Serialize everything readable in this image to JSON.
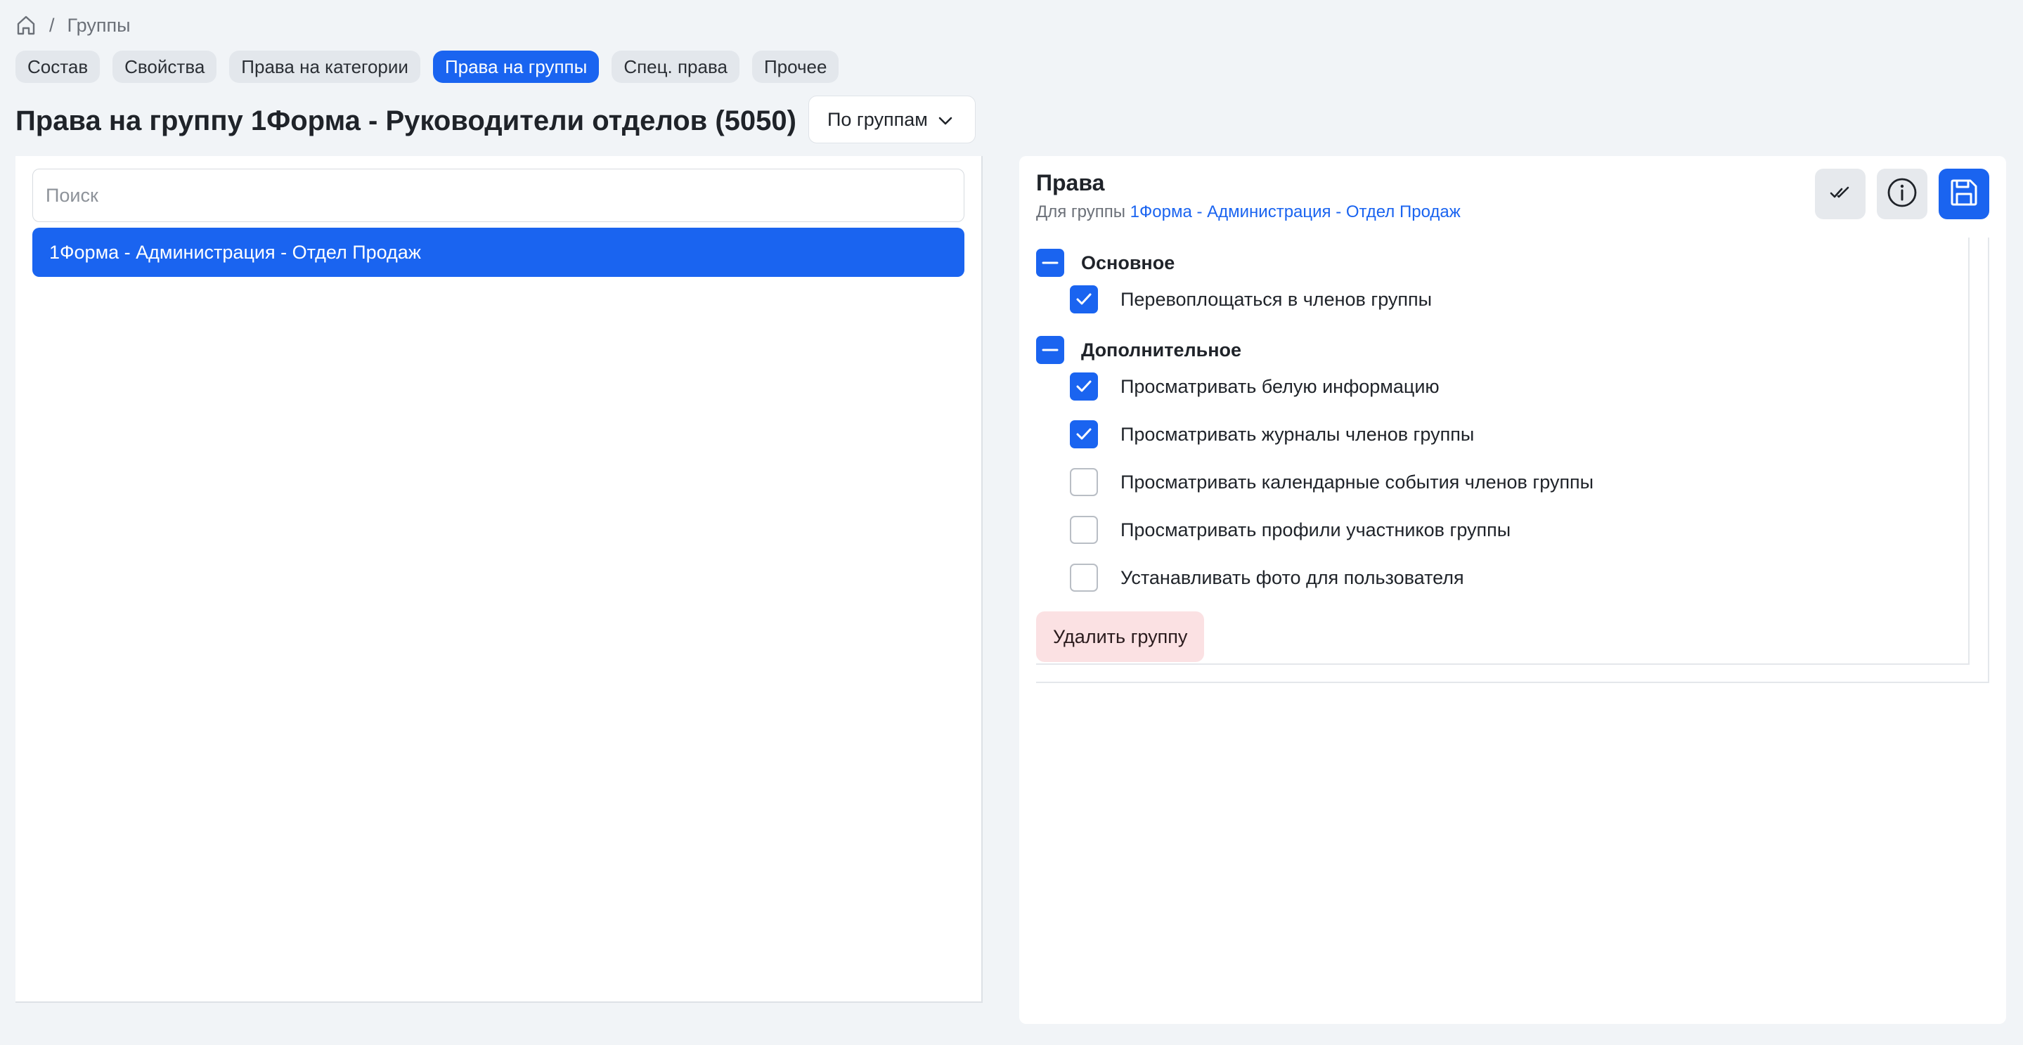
{
  "breadcrumb": {
    "home_icon": "home-icon",
    "separator": "/",
    "current": "Группы"
  },
  "tabs": [
    {
      "label": "Состав",
      "active": false
    },
    {
      "label": "Свойства",
      "active": false
    },
    {
      "label": "Права на категории",
      "active": false
    },
    {
      "label": "Права на группы",
      "active": true
    },
    {
      "label": "Спец. права",
      "active": false
    },
    {
      "label": "Прочее",
      "active": false
    }
  ],
  "page": {
    "title": "Права на группу 1Форма - Руководители отделов (5050)",
    "grouping_select": {
      "value": "По группам",
      "icon": "chevron-down-icon"
    }
  },
  "left": {
    "search_placeholder": "Поиск",
    "items": [
      {
        "label": "1Форма - Администрация - Отдел Продаж",
        "selected": true
      }
    ]
  },
  "right": {
    "title": "Права",
    "subtitle_prefix": "Для группы",
    "subtitle_group": "1Форма - Администрация - Отдел Продаж",
    "buttons": {
      "check_all_icon": "double-check-icon",
      "info_icon": "info-icon",
      "save_icon": "save-icon"
    },
    "sections": [
      {
        "label": "Основное",
        "state": "indeterminate",
        "items": [
          {
            "label": "Перевоплощаться в членов группы",
            "checked": true
          }
        ]
      },
      {
        "label": "Дополнительное",
        "state": "indeterminate",
        "items": [
          {
            "label": "Просматривать белую информацию",
            "checked": true
          },
          {
            "label": "Просматривать журналы членов группы",
            "checked": true
          },
          {
            "label": "Просматривать календарные события членов группы",
            "checked": false
          },
          {
            "label": "Просматривать профили участников группы",
            "checked": false
          },
          {
            "label": "Устанавливать фото для пользователя",
            "checked": false
          }
        ]
      }
    ],
    "delete_label": "Удалить группу"
  },
  "colors": {
    "accent": "#1a64f0",
    "background": "#f1f4f7",
    "danger_bg": "#fbe1e3"
  }
}
